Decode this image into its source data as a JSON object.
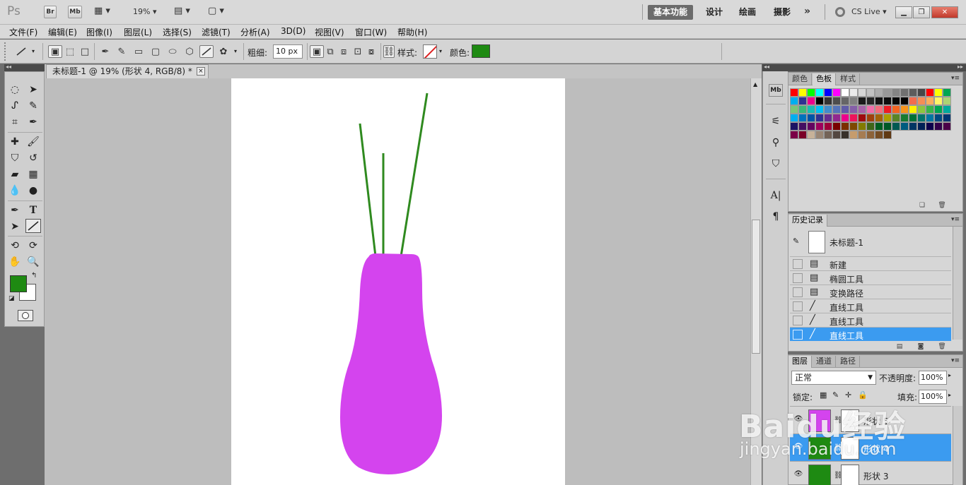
{
  "app": {
    "logo": "Ps",
    "bridge_label": "Br",
    "minibridge_label": "Mb",
    "zoom": "19%",
    "workspaces": [
      "基本功能",
      "设计",
      "绘画",
      "摄影"
    ],
    "more": "»",
    "cslive": "CS Live"
  },
  "menu": [
    "文件(F)",
    "编辑(E)",
    "图像(I)",
    "图层(L)",
    "选择(S)",
    "滤镜(T)",
    "分析(A)",
    "3D(D)",
    "视图(V)",
    "窗口(W)",
    "帮助(H)"
  ],
  "options": {
    "weight_label": "粗细:",
    "weight_value": "10 px",
    "style_label": "样式:",
    "color_label": "颜色:",
    "color": "#1e8a12"
  },
  "document": {
    "tab_title": "未标题-1 @ 19% (形状 4, RGB/8) *",
    "close": "×"
  },
  "colors": {
    "foreground": "#1e8a12",
    "background": "#ffffff",
    "vase": "#d444ee",
    "stem": "#2f8a1f",
    "selection": "#3b9bf0"
  },
  "swatch_panel": {
    "tabs": [
      "颜色",
      "色板",
      "样式"
    ],
    "active_tab": "色板"
  },
  "history_panel": {
    "tab": "历史记录",
    "snapshot": "未标题-1",
    "steps": [
      "新建",
      "椭圆工具",
      "变换路径",
      "直线工具",
      "直线工具",
      "直线工具"
    ]
  },
  "layers_panel": {
    "tabs": [
      "图层",
      "通道",
      "路径"
    ],
    "blend_mode": "正常",
    "opacity_label": "不透明度:",
    "opacity_value": "100%",
    "lock_label": "锁定:",
    "fill_label": "填充:",
    "fill_value": "100%",
    "layers": [
      "形状 5",
      "形状 4",
      "形状 3"
    ]
  },
  "watermark": {
    "text": "Baidu经验",
    "url": "jingyan.baidu.com"
  }
}
